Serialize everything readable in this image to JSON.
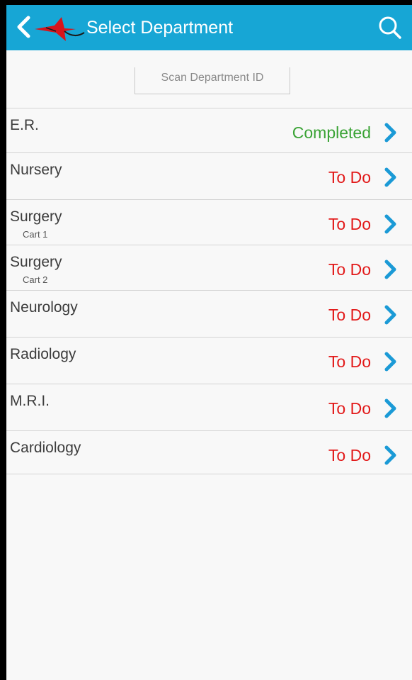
{
  "header": {
    "title": "Select Department",
    "background_color": "#17a6d5",
    "back_icon": "chevron-left-icon",
    "logo_icon": "red-bird-logo",
    "search_icon": "search-icon"
  },
  "scan": {
    "placeholder": "Scan Department ID",
    "value": ""
  },
  "status_colors": {
    "To Do": "#e21a1a",
    "Completed": "#3aa335"
  },
  "departments": [
    {
      "name": "E.R.",
      "sub": "",
      "status": "Completed"
    },
    {
      "name": "Nursery",
      "sub": "",
      "status": "To Do"
    },
    {
      "name": "Surgery",
      "sub": "Cart 1",
      "status": "To Do"
    },
    {
      "name": "Surgery",
      "sub": "Cart 2",
      "status": "To Do"
    },
    {
      "name": "Neurology",
      "sub": "",
      "status": "To Do"
    },
    {
      "name": "Radiology",
      "sub": "",
      "status": "To Do"
    },
    {
      "name": "M.R.I.",
      "sub": "",
      "status": "To Do"
    },
    {
      "name": "Cardiology",
      "sub": "",
      "status": "To Do"
    }
  ]
}
